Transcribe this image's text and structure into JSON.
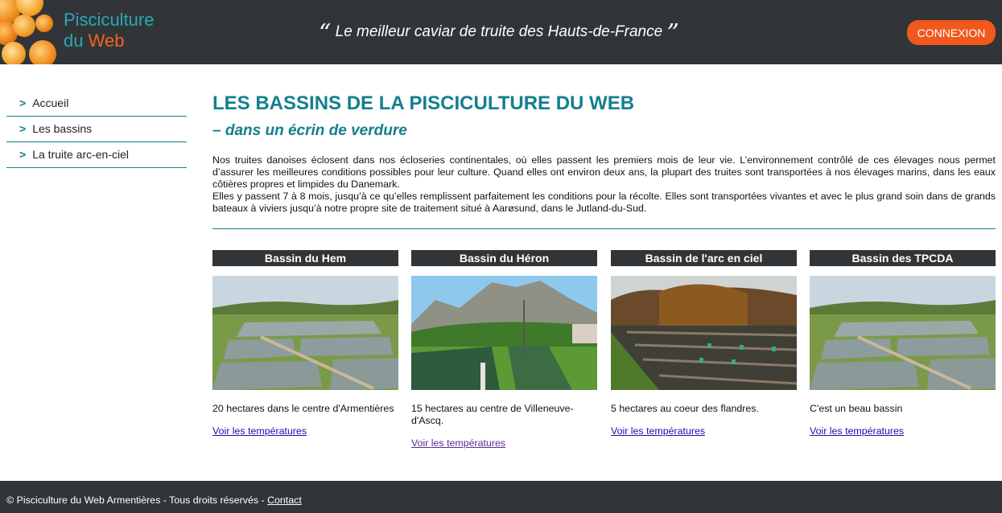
{
  "header": {
    "logo_line1": "Pisciculture",
    "logo_line2a": "du ",
    "logo_line2b": "Web",
    "tagline_open": "“",
    "tagline": " Le meilleur caviar de truite des Hauts-de-France ",
    "tagline_close": "”",
    "login_label": "CONNEXION"
  },
  "sidebar": {
    "chevron": ">",
    "items": [
      {
        "label": "Accueil"
      },
      {
        "label": "Les bassins"
      },
      {
        "label": "La truite arc-en-ciel"
      }
    ]
  },
  "main": {
    "title": "LES BASSINS DE LA PISCICULTURE DU WEB",
    "subtitle": "– dans un écrin de verdure",
    "intro_p1": "Nos truites danoises éclosent dans nos écloseries continentales, où elles passent les premiers mois de leur vie. L’environnement contrôlé de ces élevages nous permet d’assurer les meilleures conditions possibles pour leur culture. Quand elles ont environ deux ans, la plupart des truites sont transportées à nos élevages marins, dans les eaux côtières propres et limpides du Danemark.",
    "intro_p2": "Elles y passent 7 à 8 mois, jusqu’à ce qu’elles remplissent parfaitement les conditions pour la récolte. Elles sont transportées vivantes et avec le plus grand soin dans de grands bateaux à viviers jusqu’à notre propre site de traitement situé à Aarøsund, dans le Jutland-du-Sud."
  },
  "cards": [
    {
      "title": "Bassin du Hem",
      "desc": "20 hectares dans le centre d'Armentières",
      "link": "Voir les températures"
    },
    {
      "title": "Bassin du Héron",
      "desc": "15 hectares au centre de Villeneuve-d'Ascq.",
      "link": "Voir les températures"
    },
    {
      "title": "Bassin de l'arc en ciel",
      "desc": "5 hectares au coeur des flandres.",
      "link": "Voir les températures"
    },
    {
      "title": "Bassin des TPCDA",
      "desc": "C'est un beau bassin",
      "link": "Voir les températures"
    }
  ],
  "footer": {
    "text": "© Pisciculture du Web Armentières - Tous droits réservés - ",
    "contact": "Contact"
  },
  "colors": {
    "header_bg": "#323537",
    "accent": "#137f8d",
    "button": "#f0591e",
    "logo_teal": "#2aa6b8",
    "logo_orange": "#f0661f"
  }
}
